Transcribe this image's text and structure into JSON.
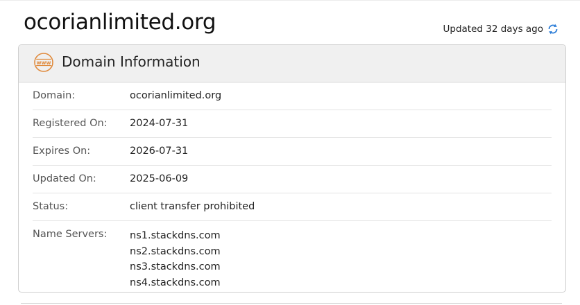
{
  "page": {
    "title": "ocorianlimited.org",
    "updated_text": "Updated 32 days ago"
  },
  "card": {
    "title": "Domain Information",
    "icon_text": "www",
    "accent_color": "#e08a3c",
    "refresh_icon_color": "#2f7fd8",
    "rows": [
      {
        "label": "Domain:",
        "value": "ocorianlimited.org"
      },
      {
        "label": "Registered On:",
        "value": "2024-07-31"
      },
      {
        "label": "Expires On:",
        "value": "2026-07-31"
      },
      {
        "label": "Updated On:",
        "value": "2025-06-09"
      },
      {
        "label": "Status:",
        "value": "client transfer prohibited"
      }
    ],
    "name_servers": {
      "label": "Name Servers:",
      "values": [
        "ns1.stackdns.com",
        "ns2.stackdns.com",
        "ns3.stackdns.com",
        "ns4.stackdns.com"
      ]
    }
  }
}
